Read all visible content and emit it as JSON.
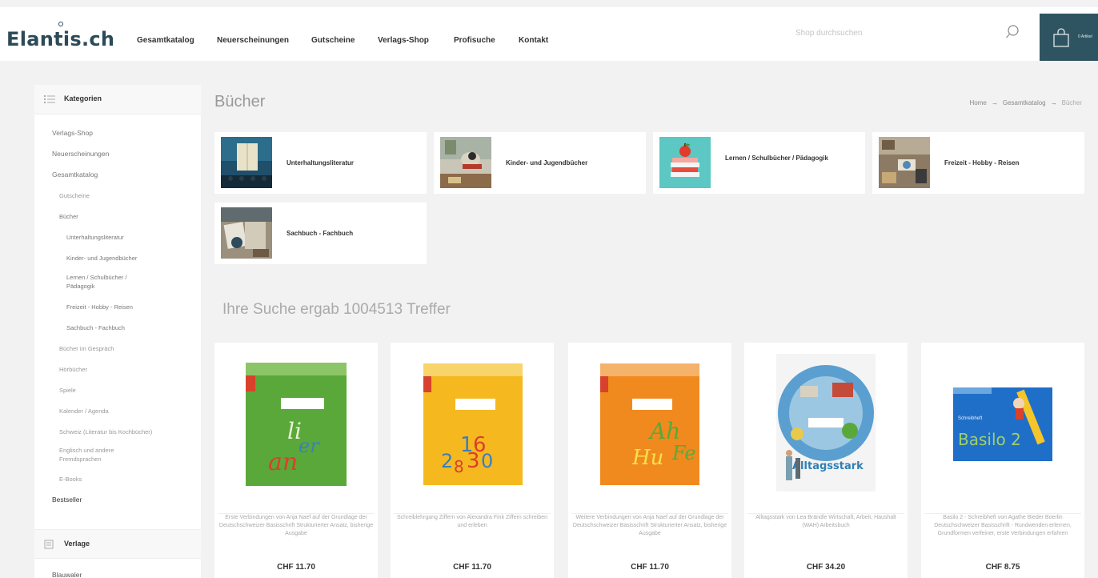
{
  "header": {
    "logo": "Elantis.ch",
    "nav": [
      {
        "label": "Gesamtkatalog"
      },
      {
        "label": "Neuerscheinungen"
      },
      {
        "label": "Gutscheine"
      },
      {
        "label": "Verlags-Shop"
      },
      {
        "label": "Profisuche"
      },
      {
        "label": "Kontakt"
      }
    ],
    "search_placeholder": "Shop durchsuchen",
    "cart_label": "0 Artikel"
  },
  "sidebar": {
    "title": "Kategorien",
    "items": [
      {
        "label": "Verlags-Shop",
        "level": 1
      },
      {
        "label": "Neuerscheinungen",
        "level": 1
      },
      {
        "label": "Gesamtkatalog",
        "level": 1
      },
      {
        "label": "Gutscheine",
        "level": 2
      },
      {
        "label": "Bücher",
        "level": 2
      },
      {
        "label": "Unterhaltungsliteratur",
        "level": 3
      },
      {
        "label": "Kinder- und Jugendbücher",
        "level": 3
      },
      {
        "label": "Lernen / Schulbücher / Pädagogik",
        "level": 3
      },
      {
        "label": "Freizeit - Hobby - Reisen",
        "level": 3
      },
      {
        "label": "Sachbuch - Fachbuch",
        "level": 3
      },
      {
        "label": "Bücher im Gespräch",
        "level": 2
      },
      {
        "label": "Hörbücher",
        "level": 2
      },
      {
        "label": "Spiele",
        "level": 2
      },
      {
        "label": "Kalender / Agenda",
        "level": 2
      },
      {
        "label": "Schweiz (Literatur bis Kochbücher)",
        "level": 2
      },
      {
        "label": "Englisch und andere Fremdsprachen",
        "level": 2
      },
      {
        "label": "E-Books",
        "level": 2
      },
      {
        "label": "Bestseller",
        "level": 1
      }
    ],
    "verlage_title": "Verlage",
    "last_item": "Blauwaler"
  },
  "main": {
    "title": "Bücher",
    "breadcrumb": [
      "Home",
      "Gesamtkatalog",
      "Bücher"
    ],
    "categories": [
      {
        "label": "Unterhaltungsliteratur"
      },
      {
        "label": "Kinder- und Jugendbücher"
      },
      {
        "label": "Lernen / Schulbücher / Pädagogik"
      },
      {
        "label": "Freizeit - Hobby - Reisen"
      },
      {
        "label": "Sachbuch - Fachbuch"
      }
    ],
    "result_title": "Ihre Suche ergab 1004513 Treffer",
    "products": [
      {
        "desc": "Erste Verbindungen von Anja Naef auf der Grundlage der Deutschschweizer Basisschrift Strukturierter Ansatz, bisherige Ausgabe",
        "price": "CHF 11.70",
        "cover_text": "li er an"
      },
      {
        "desc": "Schreiblehrgang Ziffern von Alexandra Fink Ziffern schreiben und erleben",
        "price": "CHF 11.70",
        "cover_text": "2 3 8 6 0"
      },
      {
        "desc": "Weitere Verbindungen von Anja Naef auf der Grundlage der Deutschschweizer Basisschrift Strukturierter Ansatz, bisherige Ausgabe",
        "price": "CHF 11.70",
        "cover_text": "Ah Hu Fe"
      },
      {
        "desc": "Alltagsstark von Lea Brändle Wirtschaft, Arbeit, Haushalt (WAH) Arbeitsbuch",
        "price": "CHF 34.20",
        "cover_text": "Alltagsstark"
      },
      {
        "desc": "Basilo 2 - Schreibheft von Agathe Bieder Boerlin Deutschschweizer Basisschrift - Rundwenden erlernen, Grundformen verfeiner, erste Verbindungen erfahren",
        "price": "CHF 8.75",
        "cover_text": "Basilo 2"
      }
    ]
  }
}
